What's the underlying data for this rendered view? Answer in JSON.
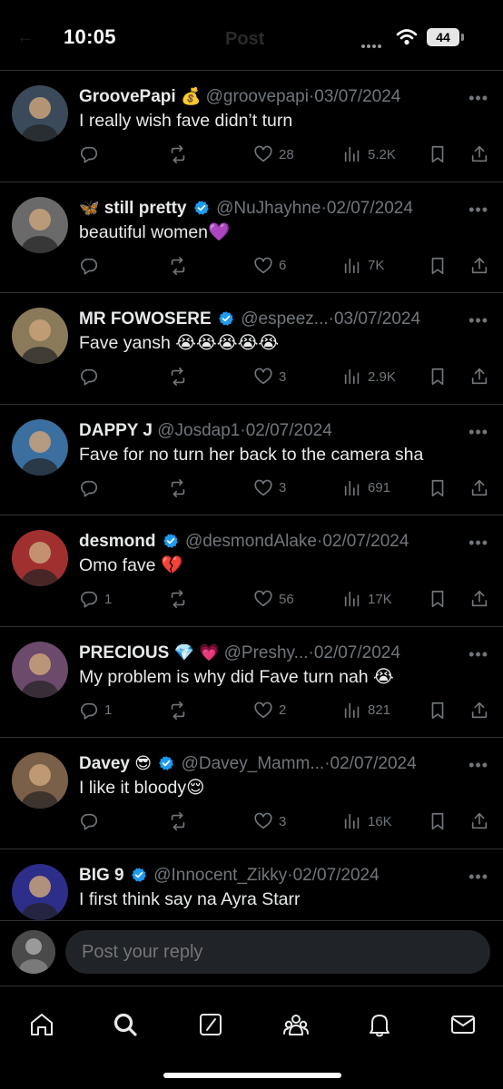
{
  "status_bar": {
    "time": "10:05",
    "battery": "44"
  },
  "header": {
    "title": "Post"
  },
  "tweets": [
    {
      "name": "GroovePapi",
      "name_emoji": "💰",
      "verified": false,
      "handle": "@groovepapi",
      "date": "03/07/2024",
      "text": "I really wish fave didn’t turn",
      "replies": "",
      "likes": "28",
      "views": "5.2K",
      "avatar_color": "#3a4a5a"
    },
    {
      "name_prefix": "🦋",
      "name": "still pretty",
      "verified": true,
      "handle": "@NuJhayhne",
      "date": "02/07/2024",
      "text": "beautiful women💜",
      "replies": "",
      "likes": "6",
      "views": "7K",
      "avatar_color": "#6a6a6a"
    },
    {
      "name": "MR FOWOSERE",
      "verified": true,
      "handle": "@espeez...",
      "date": "03/07/2024",
      "text": "Fave yansh 😭😭😭😭😭",
      "replies": "",
      "likes": "3",
      "views": "2.9K",
      "avatar_color": "#8a7a5a"
    },
    {
      "name": "DAPPY J",
      "verified": false,
      "handle": "@Josdap1",
      "date": "02/07/2024",
      "text": "Fave for no turn her back to the camera sha",
      "replies": "",
      "likes": "3",
      "views": "691",
      "avatar_color": "#3b6fa0"
    },
    {
      "name": "desmond",
      "verified": true,
      "handle": "@desmondAlake",
      "date": "02/07/2024",
      "text": "Omo fave 💔",
      "replies": "1",
      "likes": "56",
      "views": "17K",
      "avatar_color": "#a03030"
    },
    {
      "name": "PRECIOUS",
      "name_emoji": "💎 💗",
      "verified": false,
      "handle": "@Preshy...",
      "date": "02/07/2024",
      "text": "My problem is why did Fave turn nah 😭",
      "replies": "1",
      "likes": "2",
      "views": "821",
      "avatar_color": "#6b4a6b"
    },
    {
      "name": "Davey",
      "name_emoji": "😎",
      "verified": true,
      "handle": "@Davey_Mamm...",
      "date": "02/07/2024",
      "text": "I like it bloody😌",
      "replies": "",
      "likes": "3",
      "views": "16K",
      "avatar_color": "#7a6048"
    },
    {
      "name": "BIG 9",
      "verified": true,
      "handle": "@Innocent_Zikky",
      "date": "02/07/2024",
      "text": "I first think say na Ayra Starr",
      "replies": "",
      "likes": "",
      "views": "",
      "avatar_color": "#2d2d8a"
    }
  ],
  "reply": {
    "placeholder": "Post your reply"
  },
  "tabs": [
    "home-icon",
    "search-icon",
    "grok-icon",
    "communities-icon",
    "notifications-icon",
    "messages-icon"
  ],
  "colors": {
    "verified": "#1d9bf0",
    "muted": "#71767b",
    "text": "#e7e9ea",
    "border": "#2f3336"
  }
}
